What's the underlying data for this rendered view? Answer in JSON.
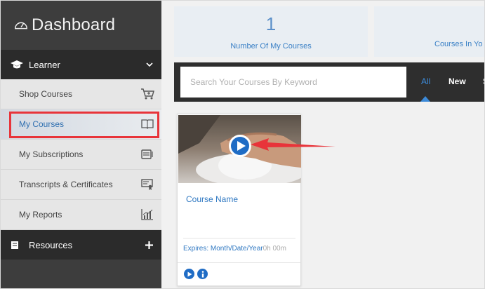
{
  "sidebar": {
    "brand_title": "Dashboard",
    "learner_label": "Learner",
    "items": [
      {
        "label": "Shop Courses",
        "icon": "cart-icon"
      },
      {
        "label": "My Courses",
        "icon": "book-icon",
        "selected": true
      },
      {
        "label": "My Subscriptions",
        "icon": "subscription-icon"
      },
      {
        "label": "Transcripts & Certificates",
        "icon": "certificate-icon"
      },
      {
        "label": "My Reports",
        "icon": "report-chart-icon"
      }
    ],
    "resources_label": "Resources"
  },
  "stats": {
    "my_courses_count": "1",
    "my_courses_label": "Number Of My Courses",
    "courses_in_label": "Courses In Yo"
  },
  "search": {
    "placeholder": "Search Your Courses By Keyword"
  },
  "tabs": {
    "all": "All",
    "new": "New",
    "more": "S"
  },
  "course_card": {
    "name": "Course Name",
    "expires": "Expires: Month/Date/Year",
    "duration": "0h 00m"
  },
  "colors": {
    "accent": "#3c8ad8",
    "highlight_box": "#e8343a",
    "sidebar_dark": "#2b2b2b"
  }
}
